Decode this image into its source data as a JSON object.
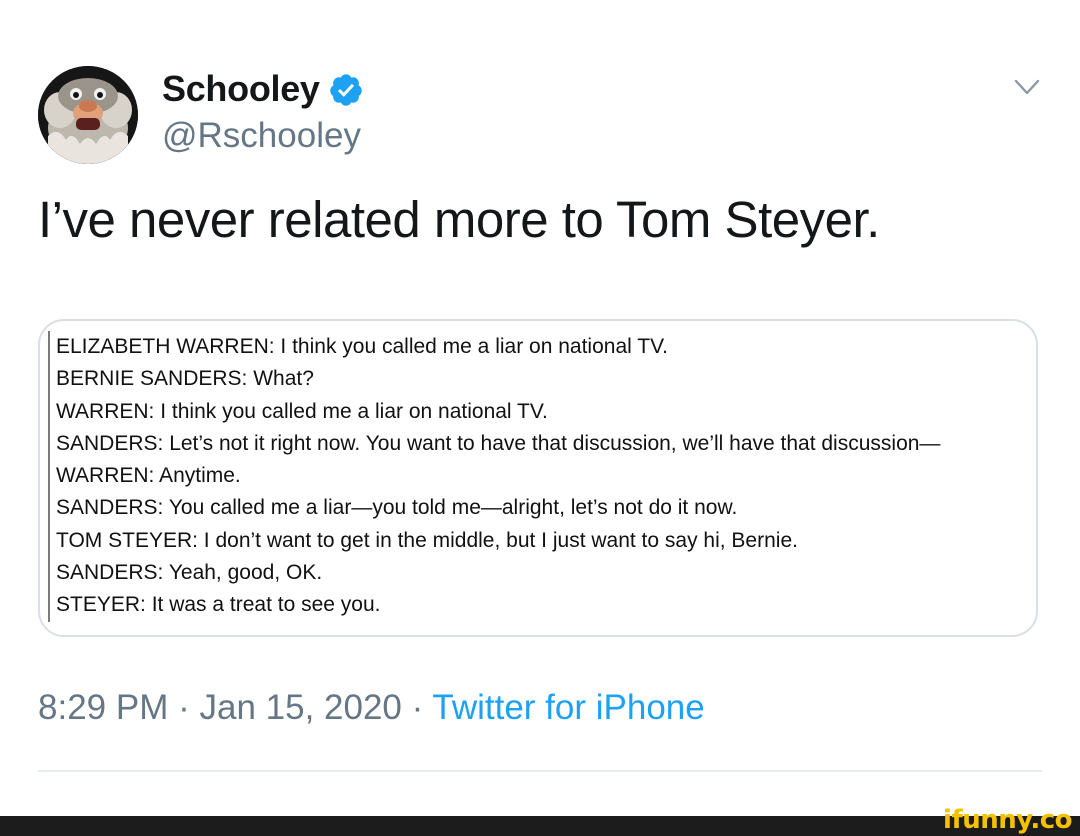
{
  "tweet": {
    "author": {
      "display_name": "Schooley",
      "handle": "@Rschooley",
      "verified": true,
      "avatar_icon": "muppet-avatar-icon"
    },
    "menu_icon": "chevron-down-icon",
    "text": "I’ve never related more to Tom Steyer.",
    "media": {
      "transcript": [
        "ELIZABETH WARREN: I think you called me a liar on national TV.",
        "BERNIE SANDERS: What?",
        "WARREN: I think you called me a liar on national TV.",
        "SANDERS: Let’s not it right now. You want to have that discussion, we’ll have that discussion—",
        "WARREN: Anytime.",
        "SANDERS: You called me a liar—you told me—alright, let’s not do it now.",
        "TOM STEYER: I don’t want to get in the middle, but I just want to say hi, Bernie.",
        "SANDERS: Yeah, good, OK.",
        "STEYER: It was a treat to see you."
      ]
    },
    "time": "8:29 PM",
    "separator": "·",
    "date": "Jan 15, 2020",
    "source": "Twitter for iPhone"
  },
  "watermark": "ifunny.co",
  "colors": {
    "text": "#14171a",
    "secondary": "#657786",
    "link": "#1da1f2",
    "verified": "#1da1f2",
    "border": "#d9dfe4",
    "watermark": "#f6c200"
  }
}
